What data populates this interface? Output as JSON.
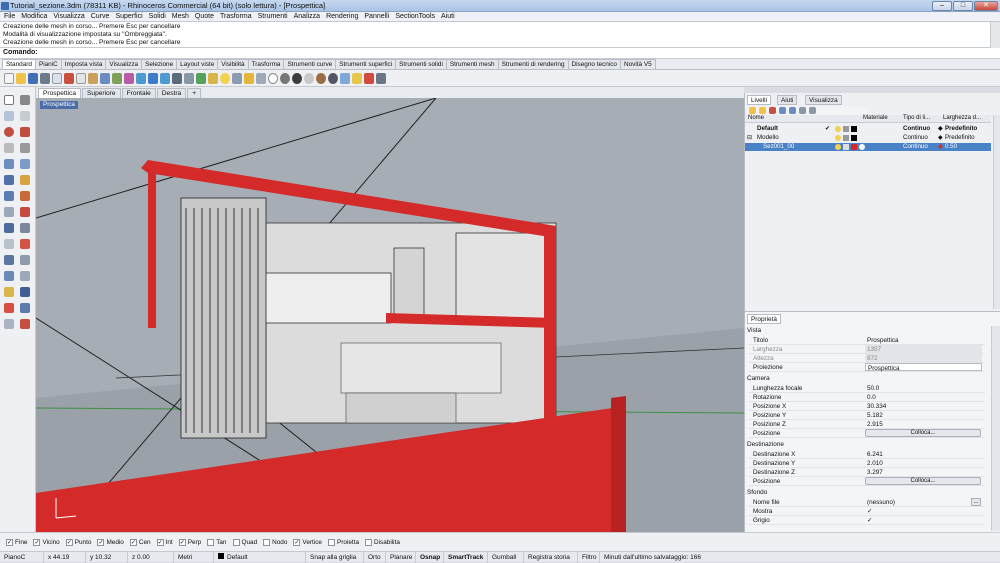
{
  "window": {
    "title": "Tutorial_sezione.3dm (78311 KB) - Rhinoceros Commercial (64 bit) (solo lettura) - [Prospettica]"
  },
  "menu": [
    "File",
    "Modifica",
    "Visualizza",
    "Curve",
    "Superfici",
    "Solidi",
    "Mesh",
    "Quote",
    "Trasforma",
    "Strumenti",
    "Analizza",
    "Rendering",
    "Pannelli",
    "SectionTools",
    "Aiuti"
  ],
  "command_history": [
    "Creazione delle mesh in corso... Premere Esc per cancellare",
    "Modalità di visualizzazione impostata su \"Ombreggiata\".",
    "Creazione delle mesh in corso... Premere Esc per cancellare"
  ],
  "command_prompt": "Comando:",
  "toolbar_tabs": [
    "Standard",
    "PianiC",
    "Imposta vista",
    "Visualizza",
    "Selezione",
    "Layout viste",
    "Visibilità",
    "Trasforma",
    "Strumenti curve",
    "Strumenti superfici",
    "Strumenti solidi",
    "Strumenti mesh",
    "Strumenti di rendering",
    "Disegno tecnico",
    "Novità V5"
  ],
  "viewport_tabs": [
    "Prospettica",
    "Superiore",
    "Frontale",
    "Destra",
    "+"
  ],
  "viewport_label": "Prospettica",
  "panel_tabs": [
    "Livelli",
    "Aiuti",
    "Visualizza"
  ],
  "layers": {
    "headers": [
      "Nome",
      "Materiale",
      "Tipo di li...",
      "Larghezza d..."
    ],
    "rows": [
      {
        "name": "Default",
        "current": "✔",
        "linetype": "Continuo",
        "width": "Predefinito"
      },
      {
        "name": "Modello",
        "current": "",
        "linetype": "Continuo",
        "width": "Predefinito"
      },
      {
        "name": "Sez001_00",
        "current": "",
        "linetype": "Continuo",
        "width": "0.50"
      }
    ]
  },
  "properties": {
    "tab": "Proprietà",
    "vista_label": "Vista",
    "vista": [
      [
        "Titolo",
        "Prospettica"
      ],
      [
        "Larghezza",
        "1357"
      ],
      [
        "Altezza",
        "872"
      ],
      [
        "Proiezione",
        "Prospettica"
      ]
    ],
    "camera_label": "Camera",
    "camera": [
      [
        "Lunghezza focale",
        "50.0"
      ],
      [
        "Rotazione",
        "0.0"
      ],
      [
        "Posizione X",
        "30.334"
      ],
      [
        "Posizione Y",
        "5.182"
      ],
      [
        "Posizione Z",
        "2.915"
      ]
    ],
    "camera_pos_label": "Posizione",
    "colloca": "Colloca...",
    "dest_label": "Destinazione",
    "dest": [
      [
        "Destinazione X",
        "6.241"
      ],
      [
        "Destinazione Y",
        "2.010"
      ],
      [
        "Destinazione Z",
        "3.297"
      ]
    ],
    "dest_pos_label": "Posizione",
    "sfondo_label": "Sfondo",
    "sfondo": [
      [
        "Nome file",
        "(nessuno)"
      ],
      [
        "Mostra",
        "✓"
      ],
      [
        "Grigio",
        "✓"
      ]
    ]
  },
  "osnaps": [
    {
      "label": "Fine",
      "checked": true
    },
    {
      "label": "Vicino",
      "checked": true
    },
    {
      "label": "Punto",
      "checked": true
    },
    {
      "label": "Medio",
      "checked": true
    },
    {
      "label": "Cen",
      "checked": true
    },
    {
      "label": "Int",
      "checked": true
    },
    {
      "label": "Perp",
      "checked": true
    },
    {
      "label": "Tan",
      "checked": false
    },
    {
      "label": "Quad",
      "checked": false
    },
    {
      "label": "Nodo",
      "checked": false
    },
    {
      "label": "Vertice",
      "checked": true
    },
    {
      "label": "Proietta",
      "checked": false
    },
    {
      "label": "Disabilita",
      "checked": false
    }
  ],
  "status": {
    "cplane": "PianoC",
    "x": "x 44.19",
    "y": "y 10.32",
    "z": "z 0.00",
    "units": "Metri",
    "layer": "Default",
    "grid": "Snap alla griglia",
    "ortho": "Orto",
    "planar": "Planare",
    "osnap": "Osnap",
    "smarttrack": "SmartTrack",
    "gumball": "Gumball",
    "history": "Registra storia",
    "filter": "Filtro",
    "autosave": "Minuti dall'ultimo salvataggio: 166"
  },
  "colors": {
    "accent": "#4a6da7",
    "section": "#d42a2a",
    "selected_row": "#4a82c8"
  }
}
